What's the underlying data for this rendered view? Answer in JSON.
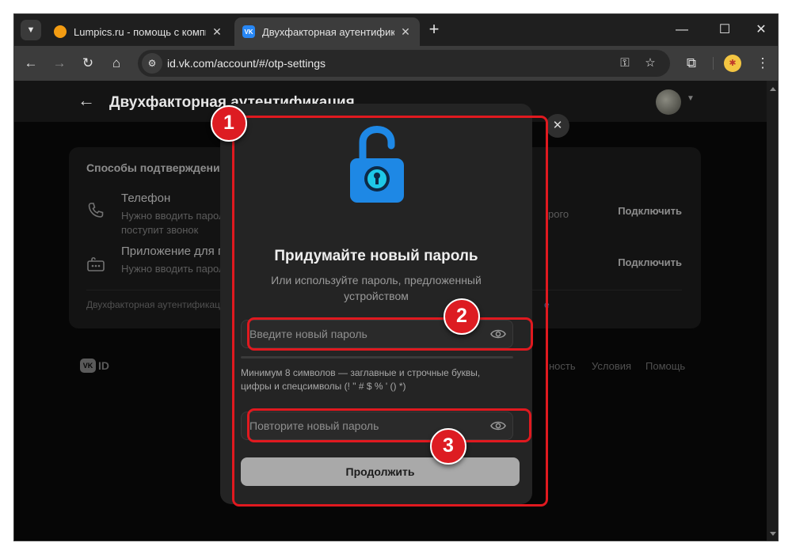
{
  "browser": {
    "tabs": [
      {
        "title": "Lumpics.ru - помощь с компь",
        "icon": "orange-circle-favicon",
        "favicon_color": "#f39c12"
      },
      {
        "title": "Двухфакторная аутентифика",
        "icon": "vk-favicon",
        "favicon_color": "#2787f5",
        "favicon_text": "VK"
      }
    ],
    "url": "id.vk.com/account/#/otp-settings",
    "accent": "#2787f5"
  },
  "page": {
    "title": "Двухфакторная аутентификация",
    "card": {
      "title": "Способы подтверждения",
      "rows": [
        {
          "icon": "phone-icon",
          "title": "Телефон",
          "desc_line1": "Нужно вводить пароль",
          "desc_tail": "рого",
          "desc_line2": "поступит звонок",
          "action": "Подключить"
        },
        {
          "icon": "authenticator-app-icon",
          "title": "Приложение для ген",
          "desc_line1": "Нужно вводить пароль",
          "action": "Подключить"
        }
      ],
      "footer": "Двухфакторная аутентификаци",
      "footer_tail": "е"
    },
    "vkid_logo": "VK",
    "vkid_text": "ID",
    "footer_links": [
      "ность",
      "Условия",
      "Помощь"
    ]
  },
  "modal": {
    "title": "Придумайте новый пароль",
    "subtitle": "Или используйте пароль, предложенный устройством",
    "new_password_placeholder": "Введите новый пароль",
    "repeat_password_placeholder": "Повторите новый пароль",
    "hint": "Минимум 8 символов — заглавные и строчные буквы, цифры и спецсимволы (! \" # $ % ' () *)",
    "continue_label": "Продолжить",
    "lock_icon": "unlocked-padlock-icon",
    "lock_color": "#1e88e5"
  },
  "annotations": {
    "badges": [
      "1",
      "2",
      "3"
    ],
    "color": "#dd1c22"
  }
}
